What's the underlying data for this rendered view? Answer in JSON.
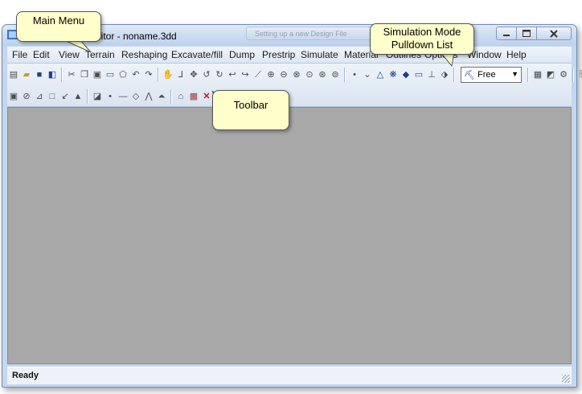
{
  "window": {
    "title": "Editor - noname.3dd",
    "title_visible": "ditor - noname.3dd",
    "background_tab": "Setting up a new Design File"
  },
  "menu": [
    {
      "label": "File"
    },
    {
      "label": "Edit"
    },
    {
      "label": "View"
    },
    {
      "label": "Terrain"
    },
    {
      "label": "Reshaping"
    },
    {
      "label": "Excavate/fill"
    },
    {
      "label": "Dump"
    },
    {
      "label": "Prestrip"
    },
    {
      "label": "Simulate"
    },
    {
      "label": "Material"
    },
    {
      "label": "Outlines"
    },
    {
      "label": "Options"
    },
    {
      "label": "Window"
    },
    {
      "label": "Help"
    }
  ],
  "toolbar": {
    "simulation_mode": {
      "value": "Free",
      "options_visible": [
        "Free"
      ]
    }
  },
  "status": {
    "text": "Ready"
  },
  "callouts": {
    "main_menu": "Main Menu",
    "simulation_mode": [
      "Simulation Mode",
      "Pulldown List"
    ],
    "toolbar": "Toolbar"
  },
  "colors": {
    "workspace": "#a8a8a8",
    "callout_fill": "#ffffcc",
    "window_frame": "#c5d7ee"
  }
}
